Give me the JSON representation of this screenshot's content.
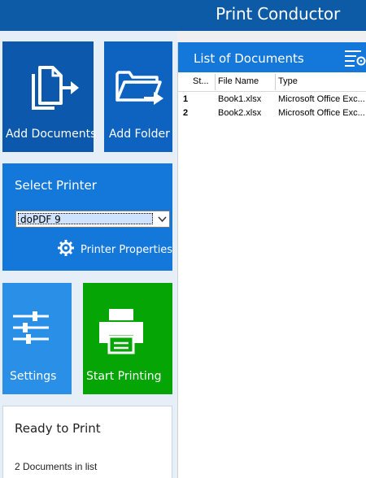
{
  "window": {
    "title": "Print Conductor"
  },
  "tiles": {
    "add_documents": "Add Documents",
    "add_folder": "Add Folder",
    "settings": "Settings",
    "start_printing": "Start Printing"
  },
  "printer_panel": {
    "title": "Select Printer",
    "selected_printer": "doPDF 9",
    "properties_label": "Printer Properties"
  },
  "status": {
    "state": "Ready to Print",
    "count_text": "2 Documents in list"
  },
  "documents": {
    "header": "List of Documents",
    "columns": [
      "St...",
      "File Name",
      "Type"
    ],
    "rows": [
      {
        "num": "1",
        "status": "",
        "file": "Book1.xlsx",
        "type": "Microsoft Office Exc..."
      },
      {
        "num": "2",
        "status": "",
        "file": "Book2.xlsx",
        "type": "Microsoft Office Exc..."
      }
    ]
  },
  "colors": {
    "title_bar": "#0d5aa7",
    "add_documents": "#0c58ad",
    "add_folder": "#0f63c0",
    "printer_panel": "#1477da",
    "settings": "#2a8fe6",
    "start_printing": "#04a504"
  }
}
